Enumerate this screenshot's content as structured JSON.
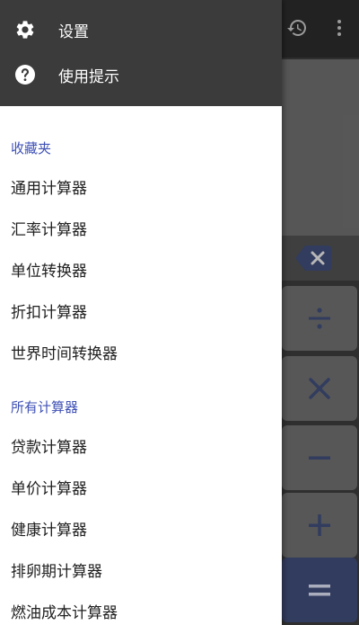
{
  "drawer": {
    "header_items": [
      {
        "label": "设置",
        "icon": "gear-icon"
      },
      {
        "label": "使用提示",
        "icon": "help-icon"
      }
    ],
    "favorites": {
      "title": "收藏夹",
      "items": [
        "通用计算器",
        "汇率计算器",
        "单位转换器",
        "折扣计算器",
        "世界时间转换器"
      ]
    },
    "all": {
      "title": "所有计算器",
      "items": [
        "贷款计算器",
        "单价计算器",
        "健康计算器",
        "排卵期计算器",
        "燃油成本计算器"
      ]
    }
  },
  "background": {
    "topbar_icons": [
      "history-icon",
      "more-vert-icon"
    ],
    "keys": [
      "backspace-icon",
      "divide-icon",
      "multiply-icon",
      "minus-icon",
      "plus-icon",
      "equals-icon"
    ]
  },
  "colors": {
    "drawer_header_bg": "#3b3b3b",
    "section_title": "#3f51b5",
    "equals_key_bg": "#3d4a73"
  }
}
